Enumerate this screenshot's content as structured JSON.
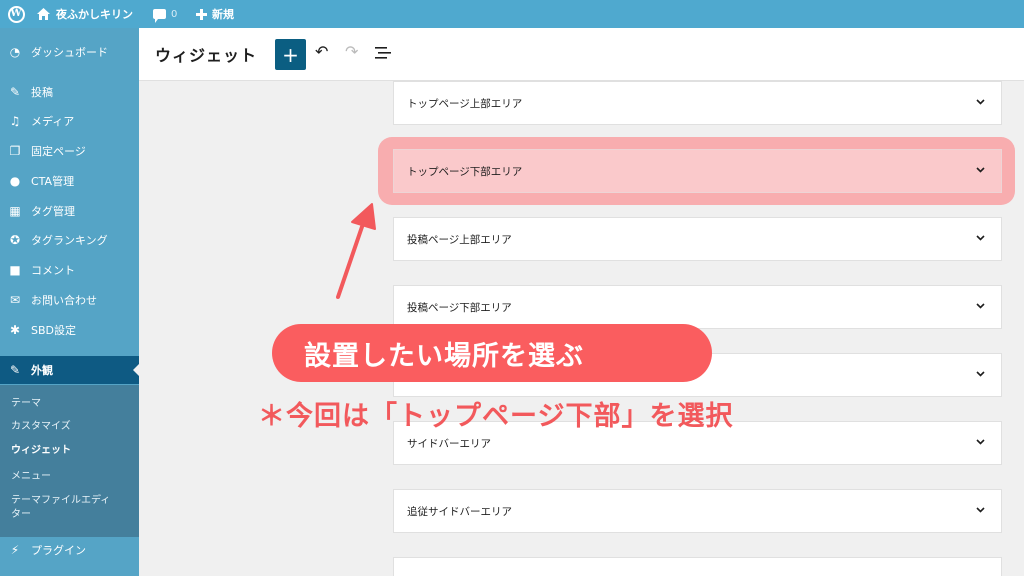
{
  "adminbar": {
    "site_name": "夜ふかしキリン",
    "comments_count": "0",
    "new_label": "新規"
  },
  "sidebar": {
    "items": [
      {
        "label": "ダッシュボード",
        "icon": "gauge-icon"
      },
      {
        "label": "投稿",
        "icon": "pin-icon"
      },
      {
        "label": "メディア",
        "icon": "media-icon"
      },
      {
        "label": "固定ページ",
        "icon": "pages-icon"
      },
      {
        "label": "CTA管理",
        "icon": "lightbulb-icon"
      },
      {
        "label": "タグ管理",
        "icon": "tag-icon"
      },
      {
        "label": "タグランキング",
        "icon": "ribbon-icon"
      },
      {
        "label": "コメント",
        "icon": "comment-icon"
      },
      {
        "label": "お問い合わせ",
        "icon": "mail-icon"
      },
      {
        "label": "SBD設定",
        "icon": "gear-icon"
      },
      {
        "label": "外観",
        "icon": "brush-icon"
      },
      {
        "label": "プラグイン",
        "icon": "plugin-icon"
      }
    ],
    "submenu": [
      "テーマ",
      "カスタマイズ",
      "ウィジェット",
      "メニュー",
      "テーマファイルエディ",
      "ター"
    ]
  },
  "header": {
    "title": "ウィジェット",
    "add_label": "+"
  },
  "panels": [
    "トップページ上部エリア",
    "トップページ下部エリア",
    "投稿ページ上部エリア",
    "投稿ページ下部エリア",
    "",
    "サイドバーエリア",
    "追従サイドバーエリア"
  ],
  "annotation": {
    "callout": "設置したい場所を選ぶ",
    "note": "＊今回は「トップページ下部」を選択",
    "accent_color": "#fa5d5f"
  }
}
